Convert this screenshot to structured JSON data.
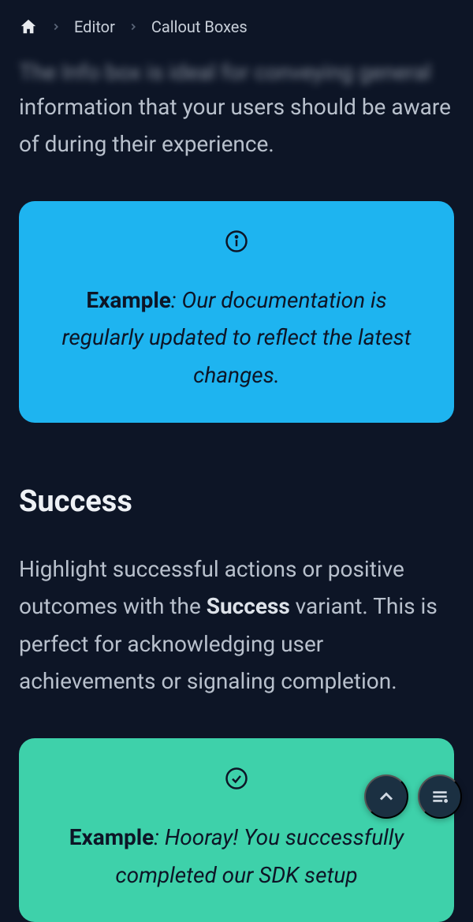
{
  "breadcrumb": {
    "home": "Home",
    "editor": "Editor",
    "current": "Callout Boxes"
  },
  "partial_line": "The Info box is ideal for conveying general",
  "intro": "information that your users should be aware of during their experience.",
  "info_callout": {
    "label": "Example",
    "colon": ": ",
    "body": "Our documentation is regularly updated to reflect the latest changes."
  },
  "success": {
    "heading": "Success",
    "text_pre": "Highlight successful actions or positive outcomes with the ",
    "text_strong": "Success",
    "text_post": " variant. This is perfect for acknowledging user achievements or signaling completion."
  },
  "success_callout": {
    "label": "Example",
    "colon": ": ",
    "body": "Hooray! You successfully completed our SDK setup"
  }
}
